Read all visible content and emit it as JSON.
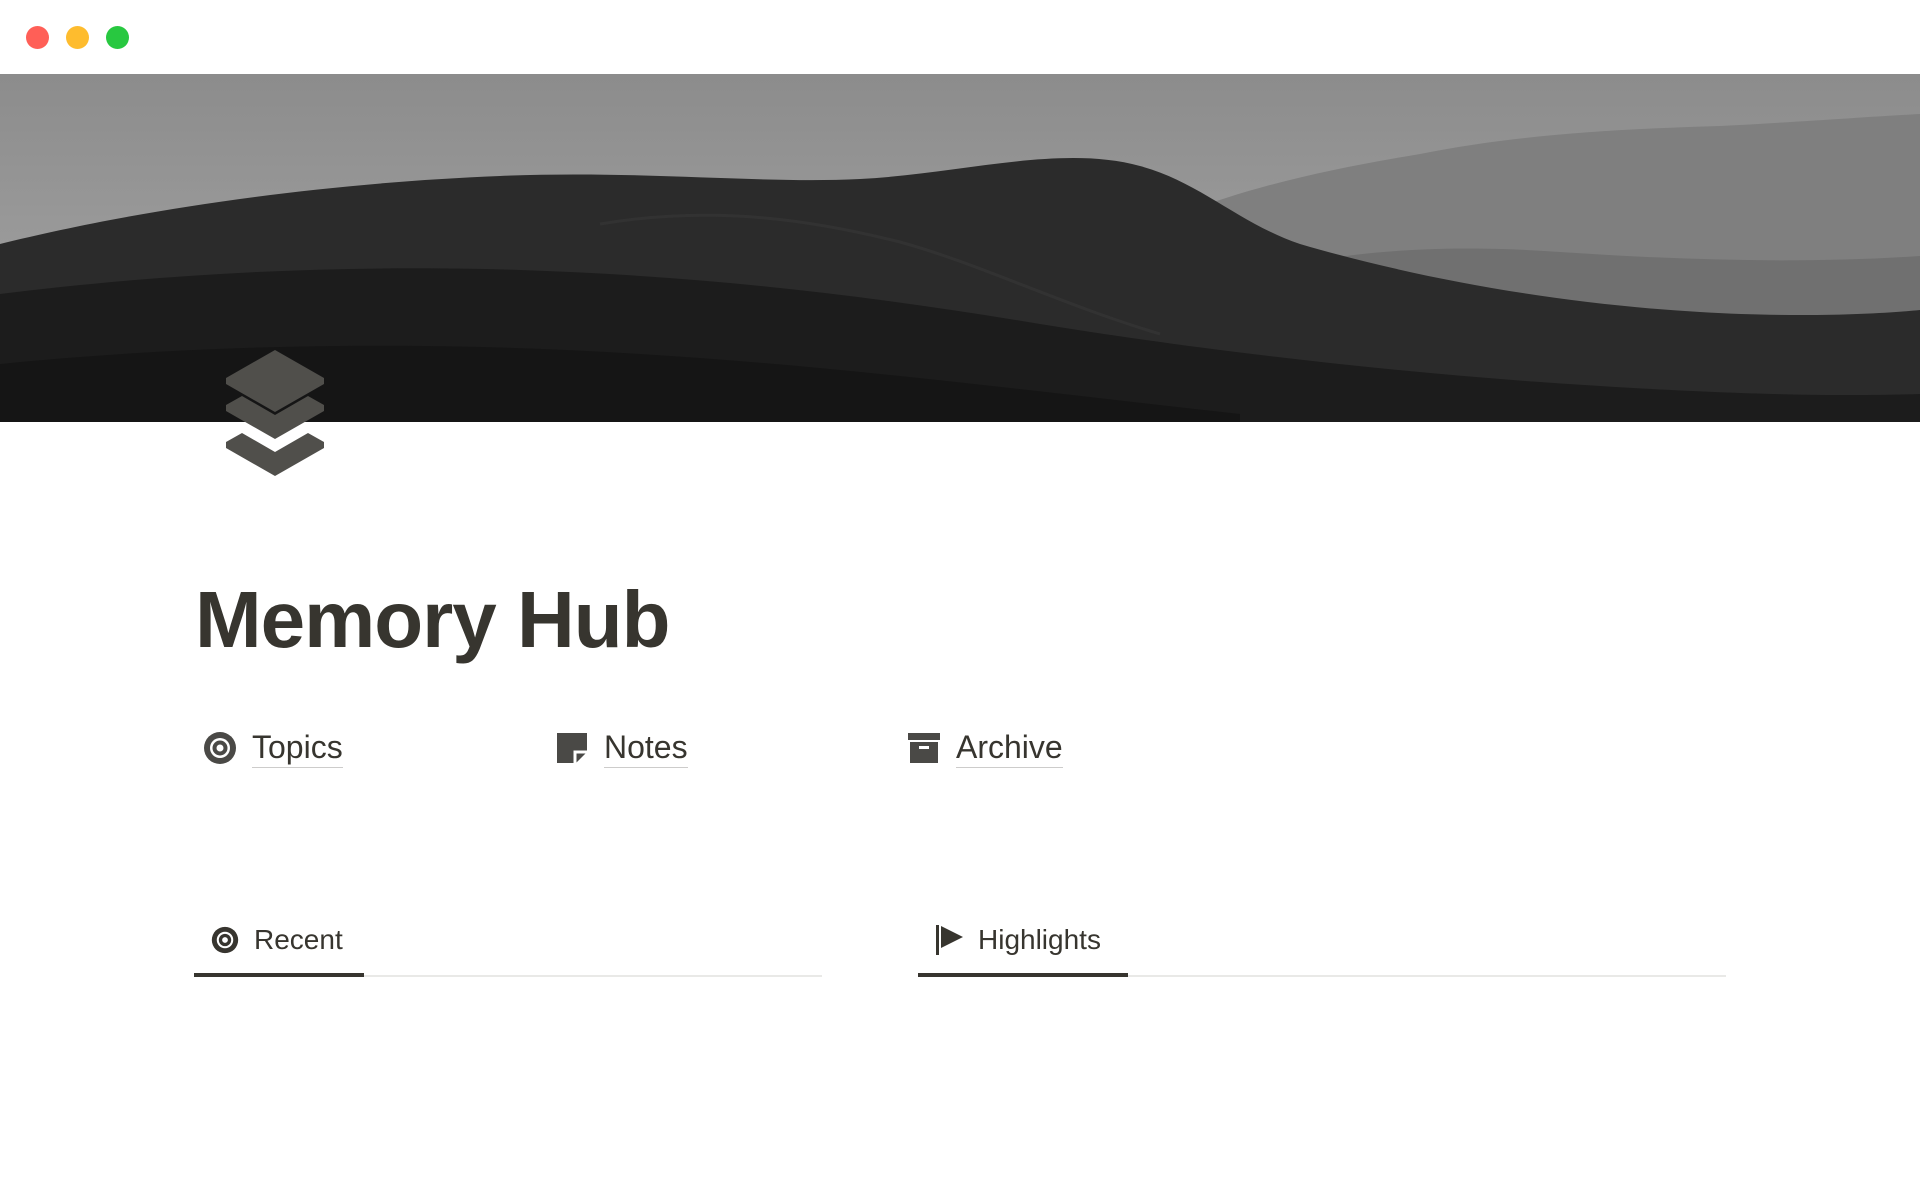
{
  "window": {
    "controls": [
      "close",
      "minimize",
      "zoom"
    ]
  },
  "cover": {
    "description_icon": "desert-dunes-cover-image"
  },
  "page": {
    "icon": "stacked-layers-icon",
    "title": "Memory Hub"
  },
  "links": [
    {
      "label": "Topics",
      "icon": "target-icon"
    },
    {
      "label": "Notes",
      "icon": "sticky-note-icon"
    },
    {
      "label": "Archive",
      "icon": "archive-box-icon"
    }
  ],
  "sections": {
    "recent": {
      "tab_label": "Recent",
      "icon": "target-icon"
    },
    "highlights": {
      "tab_label": "Highlights",
      "icon": "flag-icon"
    }
  },
  "colors": {
    "text": "#37352f",
    "icon": "#4a4946",
    "traffic_red": "#ff5f57",
    "traffic_yellow": "#febc2e",
    "traffic_green": "#28c840"
  }
}
